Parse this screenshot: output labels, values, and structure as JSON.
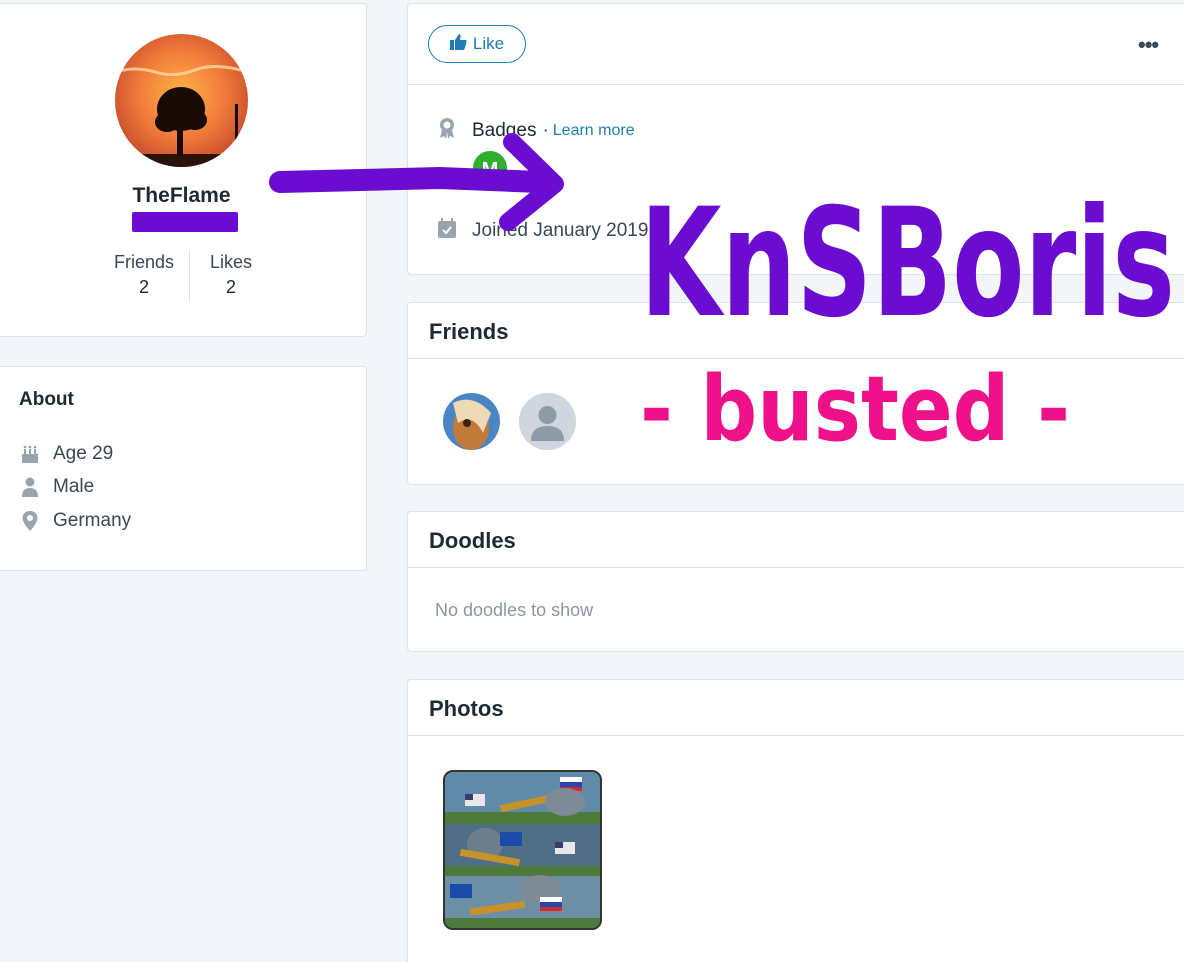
{
  "profile": {
    "username": "TheFlame",
    "friends_label": "Friends",
    "friends_count": "2",
    "likes_label": "Likes",
    "likes_count": "2"
  },
  "about": {
    "title": "About",
    "age": "Age 29",
    "gender": "Male",
    "location": "Germany"
  },
  "actions": {
    "like_label": "Like",
    "more_label": "•••",
    "badges_label": "Badges",
    "badges_sep": "·",
    "learn_more": "Learn more",
    "badge_letter": "M",
    "joined": "Joined January 2019"
  },
  "friends_section": {
    "title": "Friends"
  },
  "doodles_section": {
    "title": "Doodles",
    "empty": "No doodles to show"
  },
  "photos_section": {
    "title": "Photos"
  },
  "annotations": {
    "big_text": "KnSBoris",
    "sub_text": "- busted -",
    "purple": "#6a0dd1",
    "pink": "#ee1189"
  },
  "colors": {
    "accent": "#1f7db5",
    "badge_green": "#2fae2f"
  }
}
